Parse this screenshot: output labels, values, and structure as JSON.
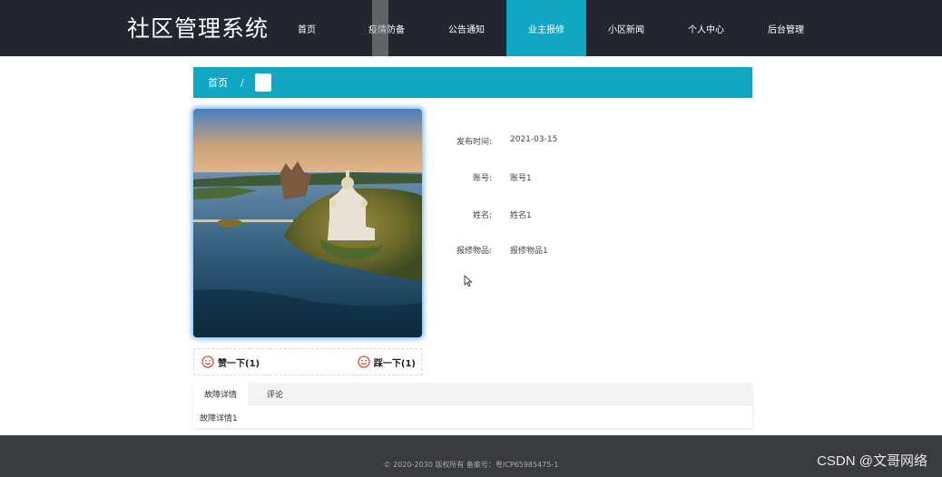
{
  "header": {
    "site_title": "社区管理系统",
    "nav": [
      {
        "label": "首页",
        "active": false
      },
      {
        "label": "疫情防备",
        "active": false
      },
      {
        "label": "公告通知",
        "active": false
      },
      {
        "label": "业主报修",
        "active": true
      },
      {
        "label": "小区新闻",
        "active": false
      },
      {
        "label": "个人中心",
        "active": false
      },
      {
        "label": "后台管理",
        "active": false
      }
    ]
  },
  "breadcrumb": {
    "home": "首页",
    "separator": "/"
  },
  "detail": {
    "photo_alt": "aerial lake island cathedral photo",
    "fields": [
      {
        "label": "发布时间:",
        "value": "2021-03-15"
      },
      {
        "label": "账号:",
        "value": "账号1"
      },
      {
        "label": "姓名:",
        "value": "姓名1"
      },
      {
        "label": "报修物品:",
        "value": "报修物品1"
      }
    ],
    "like_label": "赞一下(1)",
    "dislike_label": "踩一下(1)"
  },
  "tabs": {
    "items": [
      "故障详情",
      "评论"
    ],
    "active_index": 0,
    "content": "故障详情1"
  },
  "footer": {
    "copyright": "© 2020-2030 版权所有 备案号：粤ICP65985475-1",
    "watermark": "CSDN @文哥网络"
  },
  "colors": {
    "header_bg": "#23262e",
    "accent": "#11a7c4",
    "footer_bg": "#3a3b3e",
    "icon_red": "#e14a3b"
  }
}
